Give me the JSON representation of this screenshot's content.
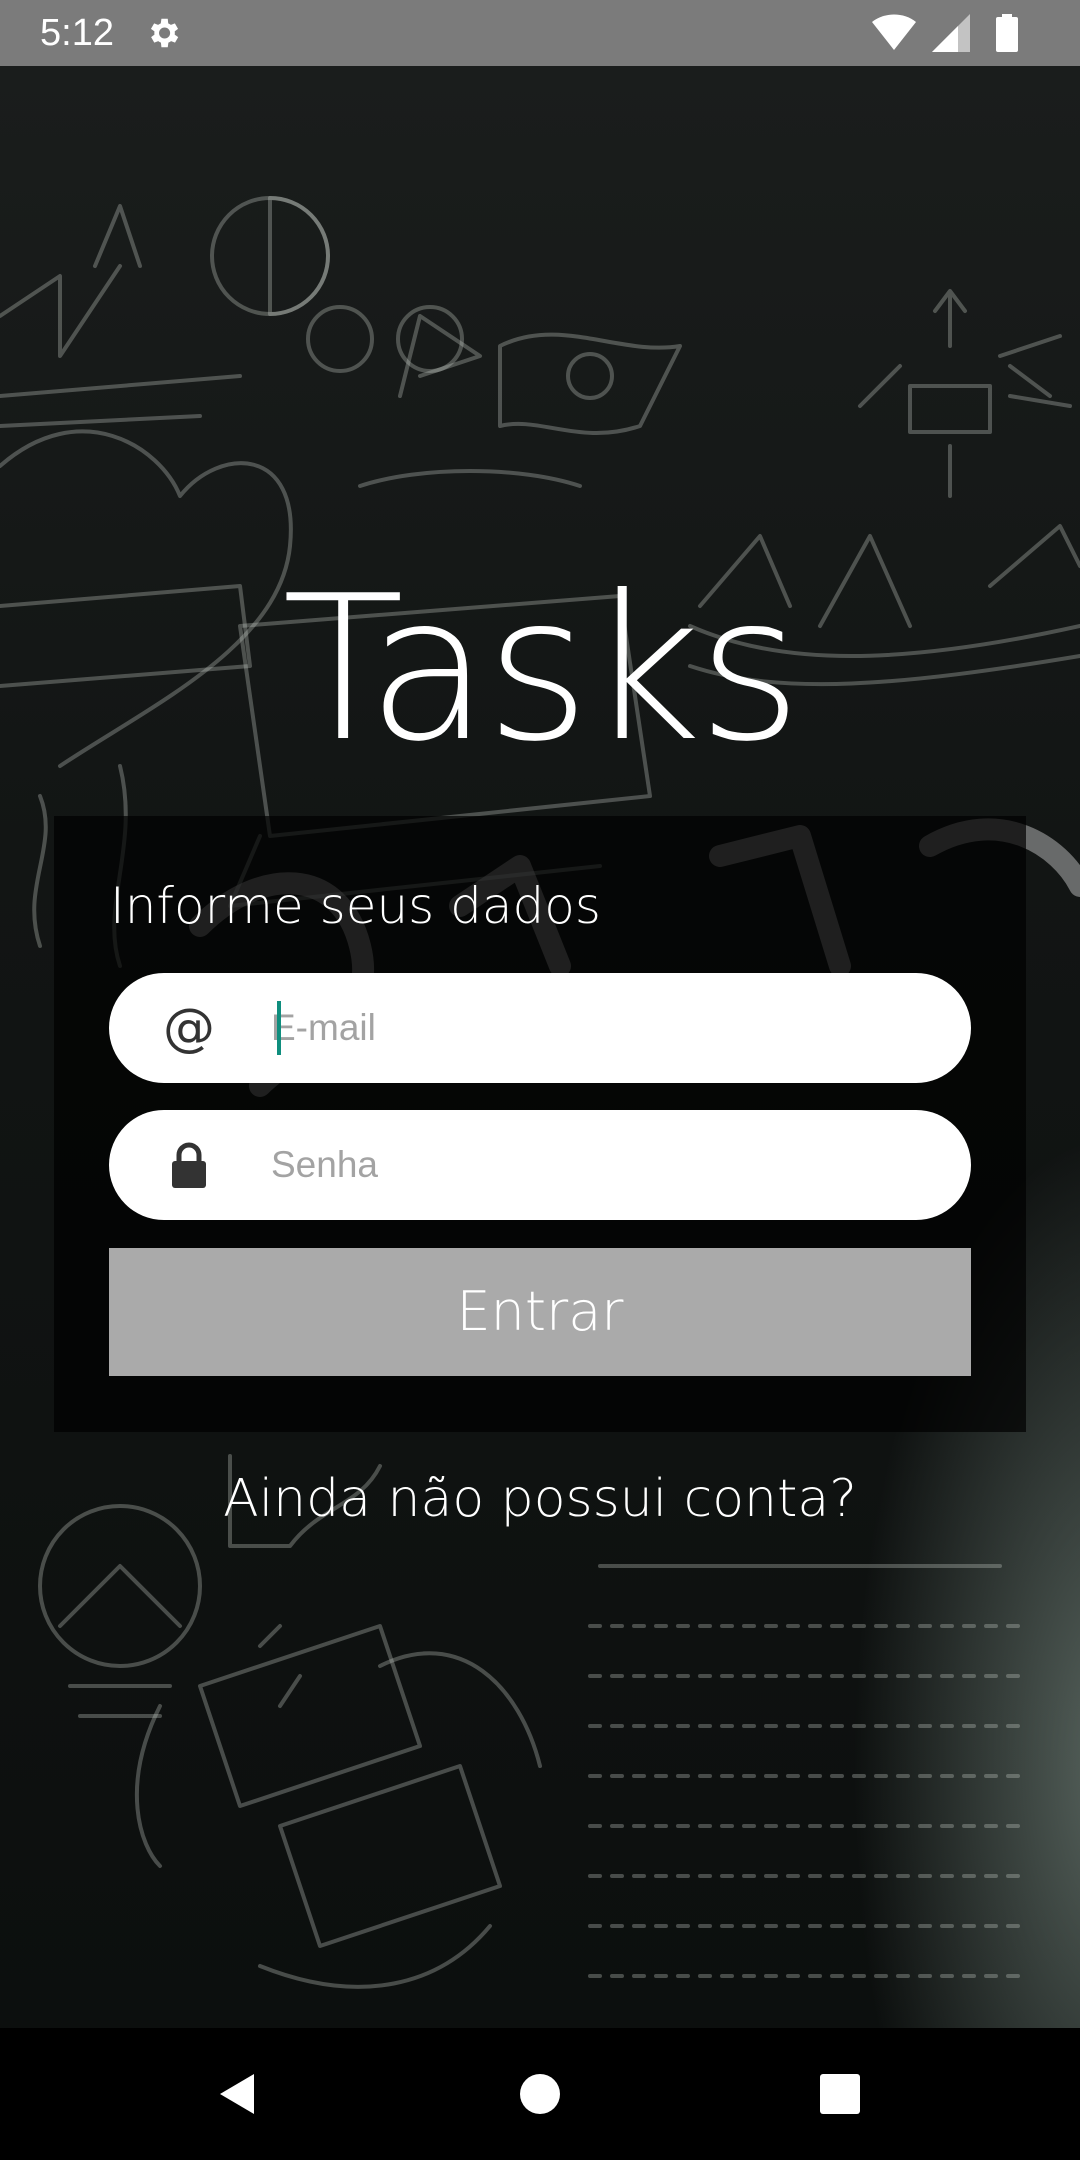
{
  "status_bar": {
    "time": "5:12",
    "icons": [
      "settings-icon",
      "wifi-icon",
      "signal-icon",
      "battery-icon"
    ]
  },
  "app": {
    "title": "Tasks"
  },
  "form": {
    "subtitle": "Informe seus dados",
    "email": {
      "icon": "at-icon",
      "icon_glyph": "@",
      "placeholder": "E-mail",
      "value": ""
    },
    "password": {
      "icon": "lock-icon",
      "placeholder": "Senha",
      "value": ""
    },
    "submit_label": "Entrar"
  },
  "register": {
    "label": "Ainda não possui conta?"
  },
  "navigation": {
    "buttons": [
      "back",
      "home",
      "recents"
    ]
  },
  "colors": {
    "status_bar": "#7b7b7b",
    "button_background": "#aaaaaa",
    "caret": "#0f8e7e",
    "input_background": "#ffffff"
  }
}
